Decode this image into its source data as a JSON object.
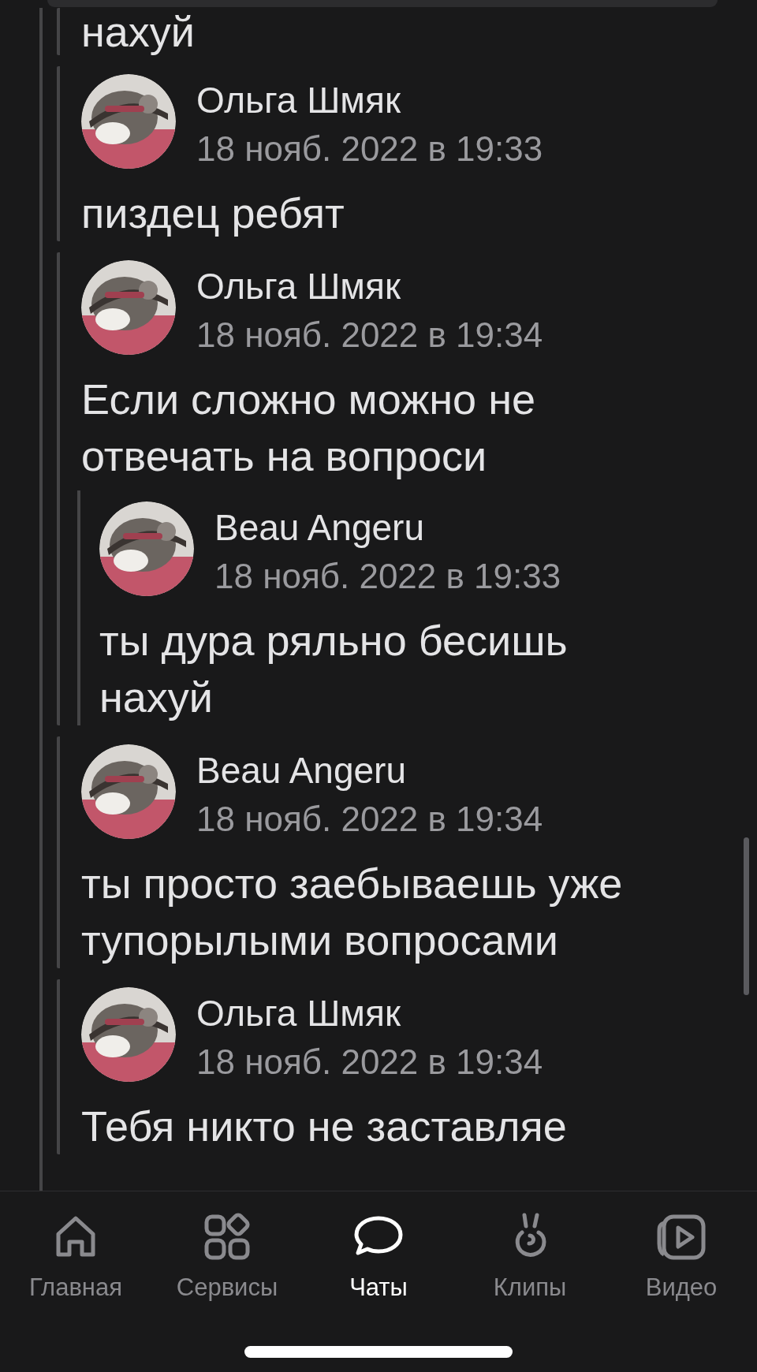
{
  "top_fragment": {
    "text": "нахуй"
  },
  "messages": [
    {
      "author": "Ольга Шмяк",
      "time": "18 нояб. 2022 в 19:33",
      "text": "пиздец ребят"
    },
    {
      "author": "Ольга Шмяк",
      "time": "18 нояб. 2022 в 19:34",
      "text": "Если сложно можно не отвечать на вопроси",
      "forwarded": [
        {
          "author": "Beau Angeru",
          "time": "18 нояб. 2022 в 19:33",
          "text": "ты дура ряльно бесишь нахуй"
        }
      ]
    },
    {
      "author": "Beau Angeru",
      "time": "18 нояб. 2022 в 19:34",
      "text": "ты просто заебываешь уже тупорылыми вопросами"
    },
    {
      "author": "Ольга Шмяк",
      "time": "18 нояб. 2022 в 19:34",
      "text": "Тебя никто не заставляе"
    }
  ],
  "tab_bar": [
    {
      "label": "Главная",
      "kind": "home",
      "selected": false
    },
    {
      "label": "Сервисы",
      "kind": "services",
      "selected": false
    },
    {
      "label": "Чаты",
      "kind": "chats",
      "selected": true
    },
    {
      "label": "Клипы",
      "kind": "clips",
      "selected": false
    },
    {
      "label": "Видео",
      "kind": "video",
      "selected": false
    }
  ]
}
